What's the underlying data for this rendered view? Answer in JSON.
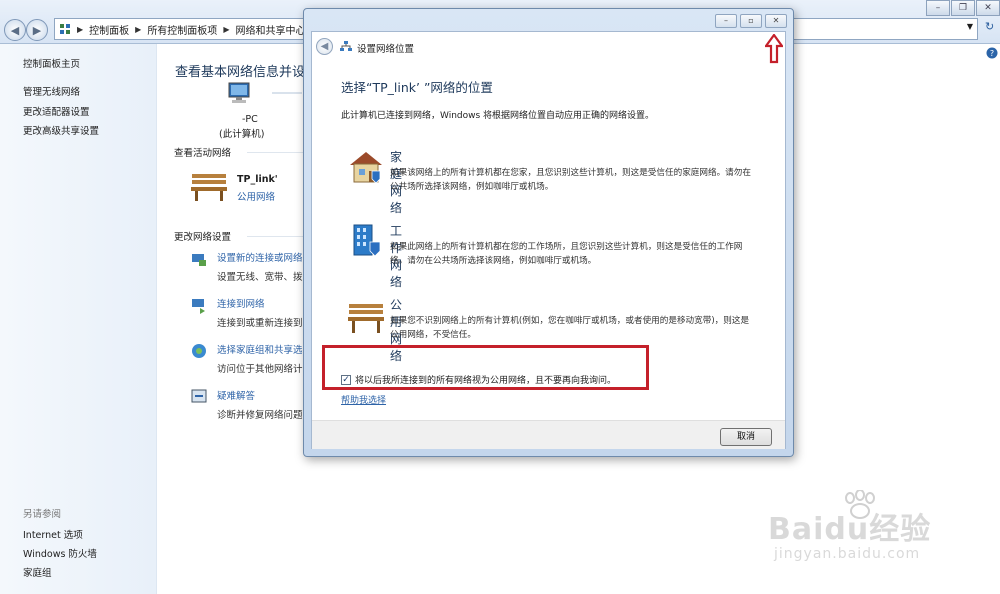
{
  "breadcrumb": [
    "控制面板",
    "所有控制面板项",
    "网络和共享中心"
  ],
  "left_pane": {
    "links": [
      "控制面板主页",
      "管理无线网络",
      "更改适配器设置",
      "更改高级共享设置"
    ],
    "see_also_label": "另请参阅",
    "see_also": [
      "Internet 选项",
      "Windows 防火墙",
      "家庭组"
    ]
  },
  "main": {
    "heading": "查看基本网络信息并设置",
    "pc_name": "-PC",
    "pc_sub": "(此计算机)",
    "active_label": "查看活动网络",
    "network_name": "TP_link'",
    "network_type": "公用网络",
    "change_label": "更改网络设置",
    "tasks": [
      {
        "title": "设置新的连接或网络",
        "desc": "设置无线、宽带、拨"
      },
      {
        "title": "连接到网络",
        "desc": "连接到或重新连接到"
      },
      {
        "title": "选择家庭组和共享选",
        "desc": "访问位于其他网络计"
      },
      {
        "title": "疑难解答",
        "desc": "诊断并修复网络问题"
      }
    ]
  },
  "dialog": {
    "title": "设置网络位置",
    "heading": "选择“TP_link’ ”网络的位置",
    "intro": "此计算机已连接到网络，Windows 将根据网络位置自动应用正确的网络设置。",
    "options": [
      {
        "name": "家庭网络",
        "desc": "如果该网络上的所有计算机都在您家，且您识别这些计算机，则这是受信任的家庭网络。请勿在公共场所选择该网络，例如咖啡厅或机场。",
        "icon": "house-icon"
      },
      {
        "name": "工作网络",
        "desc": "如果此网络上的所有计算机都在您的工作场所，且您识别这些计算机，则这是受信任的工作网络。请勿在公共场所选择该网络，例如咖啡厅或机场。",
        "icon": "office-building-icon"
      },
      {
        "name": "公用网络",
        "desc": "如果您不识别网络上的所有计算机(例如，您在咖啡厅或机场，或者使用的是移动宽带)，则这是公用网络，不受信任。",
        "icon": "bench-icon"
      }
    ],
    "checkbox_label": "将以后我所连接到的所有网络视为公用网络，且不要再向我询问。",
    "checkbox_checked": true,
    "help_link": "帮助我选择",
    "cancel": "取消"
  },
  "watermark": {
    "line1": "Baidu经验",
    "line2": "jingyan.baidu.com"
  },
  "colors": {
    "accent_link": "#2f64a8",
    "heading": "#1e395b",
    "highlight_box": "#c4202a"
  }
}
